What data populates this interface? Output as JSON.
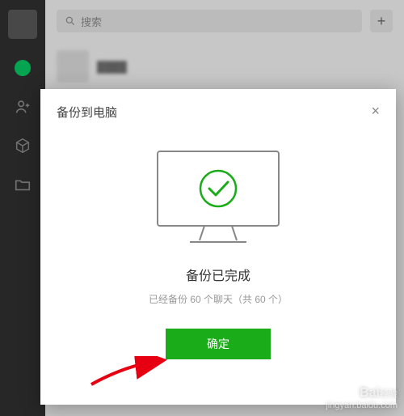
{
  "search": {
    "placeholder": "搜索"
  },
  "modal": {
    "title": "备份到电脑",
    "done_title": "备份已完成",
    "done_sub": "已经备份 60 个聊天（共 60 个）",
    "confirm_label": "确定"
  },
  "watermark": {
    "brand": "Bai",
    "brand2": "经验",
    "sub": "jingyan.baidu.com"
  }
}
